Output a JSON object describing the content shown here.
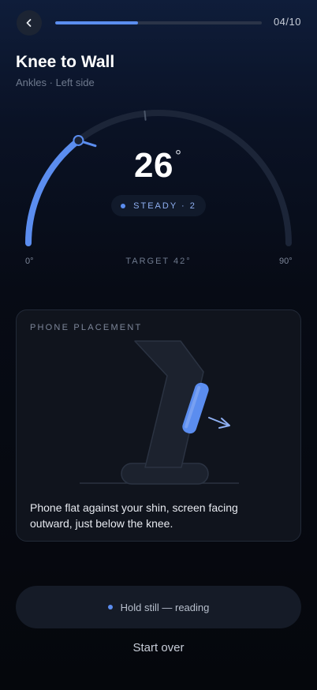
{
  "header": {
    "back_icon": "chevron-left-icon",
    "progress": 0.4,
    "step_counter": "04/10"
  },
  "exercise": {
    "title": "Knee to Wall",
    "subtitle": "Ankles · Left side"
  },
  "gauge": {
    "value": 26,
    "value_text": "26",
    "degree_symbol": "°",
    "min_label": "0°",
    "max_label": "90°",
    "min": 0,
    "max": 90,
    "target": 42,
    "target_label": "TARGET 42°",
    "status_label": "STEADY · 2",
    "accent_color": "#5b8def",
    "track_color": "#1c2538"
  },
  "placement": {
    "heading": "PHONE PLACEMENT",
    "instruction": "Phone flat against your shin, screen facing outward, just below the knee."
  },
  "status": {
    "message": "Hold still — reading"
  },
  "actions": {
    "start_over": "Start over"
  }
}
